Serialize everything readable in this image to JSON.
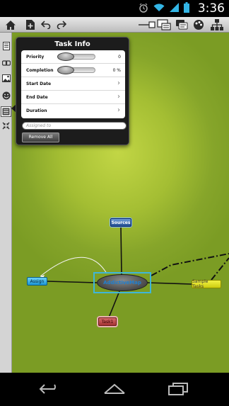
{
  "status_bar": {
    "time": "3:36",
    "icons": [
      "alarm-icon",
      "wifi-icon",
      "signal-icon",
      "battery-icon"
    ]
  },
  "toolbar": {
    "left_icons": [
      "home-icon",
      "add-document-icon",
      "undo-icon",
      "redo-icon"
    ],
    "right_icons": [
      "link-style-icon",
      "node-style-icon",
      "chat-icon",
      "color-palette-icon",
      "hierarchy-icon"
    ]
  },
  "rail": {
    "icons": [
      "notes-icon",
      "link-icon",
      "image-icon",
      "smiley-icon",
      "task-icon",
      "collapse-icon"
    ]
  },
  "task_info": {
    "title": "Task Info",
    "priority_label": "Priority",
    "priority_value": "0",
    "priority_level": 0,
    "completion_label": "Completion",
    "completion_value": "0 %",
    "completion_level": 0,
    "start_date_label": "Start Date",
    "end_date_label": "End Date",
    "duration_label": "Duration",
    "assigned_placeholder": "Assigned to",
    "remove_all_label": "Remove All"
  },
  "mindmap": {
    "central": "AddictiveMap",
    "sources": "Sources",
    "assign": "Assign",
    "sample_tasks": "Sample Tasks",
    "task1": "Task1"
  },
  "colors": {
    "canvas": "#a4be33",
    "panel": "#1c1c1c",
    "central_text": "#1f7fd0"
  }
}
